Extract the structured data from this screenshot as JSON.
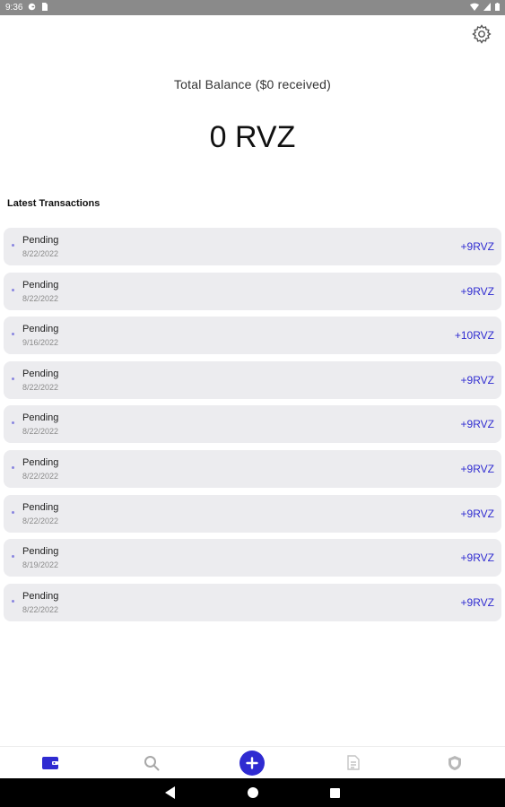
{
  "status_bar": {
    "time": "9:36",
    "icons": [
      "g-icon",
      "sim-card-icon"
    ],
    "right_icons": [
      "wifi-icon",
      "signal-icon",
      "battery-icon"
    ]
  },
  "header": {
    "settings_icon": "gear-icon"
  },
  "balance": {
    "label": "Total Balance  ($0  received)",
    "amount": "0 RVZ"
  },
  "transactions": {
    "title": "Latest Transactions",
    "items": [
      {
        "status": "Pending",
        "date": "8/22/2022",
        "amount": "+9RVZ"
      },
      {
        "status": "Pending",
        "date": "8/22/2022",
        "amount": "+9RVZ"
      },
      {
        "status": "Pending",
        "date": "9/16/2022",
        "amount": "+10RVZ"
      },
      {
        "status": "Pending",
        "date": "8/22/2022",
        "amount": "+9RVZ"
      },
      {
        "status": "Pending",
        "date": "8/22/2022",
        "amount": "+9RVZ"
      },
      {
        "status": "Pending",
        "date": "8/22/2022",
        "amount": "+9RVZ"
      },
      {
        "status": "Pending",
        "date": "8/22/2022",
        "amount": "+9RVZ"
      },
      {
        "status": "Pending",
        "date": "8/19/2022",
        "amount": "+9RVZ"
      },
      {
        "status": "Pending",
        "date": "8/22/2022",
        "amount": "+9RVZ"
      }
    ]
  },
  "bottom_nav": {
    "items": [
      "wallet-icon",
      "search-icon",
      "add-icon",
      "document-icon",
      "shield-icon"
    ],
    "active": "wallet-icon",
    "accent_color": "#2f2bd1"
  },
  "system_nav": [
    "back-icon",
    "home-icon",
    "recents-icon"
  ]
}
